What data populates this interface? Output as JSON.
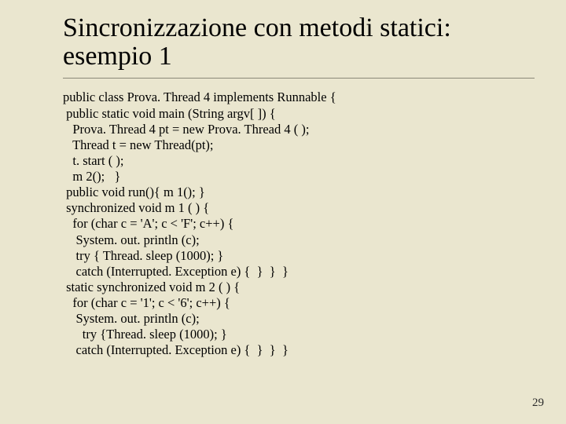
{
  "title_line1": "Sincronizzazione con metodi statici:",
  "title_line2": "esempio 1",
  "code": {
    "l01": "public class Prova. Thread 4 implements Runnable {",
    "l02": " public static void main (String argv[ ]) {",
    "l03": "   Prova. Thread 4 pt = new Prova. Thread 4 ( );",
    "l04": "   Thread t = new Thread(pt);",
    "l05": "   t. start ( );",
    "l06": "   m 2();   }",
    "l07": " public void run(){ m 1(); }",
    "l08": " synchronized void m 1 ( ) {",
    "l09": "   for (char c = 'A'; c < 'F'; c++) {",
    "l10": "    System. out. println (c);",
    "l11": "    try { Thread. sleep (1000); }",
    "l12": "    catch (Interrupted. Exception e) {  }  }  }",
    "l13": " static synchronized void m 2 ( ) {",
    "l14": "   for (char c = '1'; c < '6'; c++) {",
    "l15": "    System. out. println (c);",
    "l16": "      try {Thread. sleep (1000); }",
    "l17": "    catch (Interrupted. Exception e) {  }  }  }"
  },
  "page_number": "29"
}
